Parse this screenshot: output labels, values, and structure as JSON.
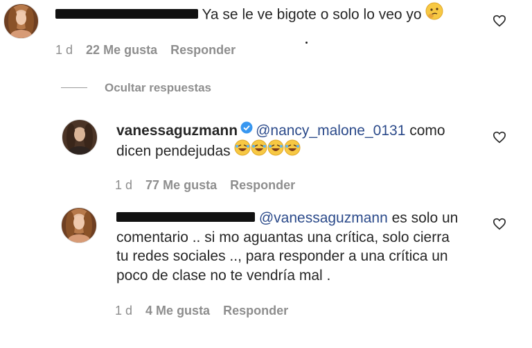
{
  "comments": [
    {
      "text": "Ya se le ve bigote o solo lo veo yo",
      "emoji": "thinking-face",
      "time": "1 d",
      "likes": "22 Me gusta",
      "reply": "Responder"
    },
    {
      "username": "vanessaguzmann",
      "mention": "@nancy_malone_0131",
      "text_line1": "como",
      "text_line2": "dicen pendejudas",
      "emoji": "rolling-on-floor-laughing",
      "time": "1 d",
      "likes": "77 Me gusta",
      "reply": "Responder"
    },
    {
      "mention": "@vanessaguzmann",
      "text_line1": "es solo un",
      "text_line2": "comentario .. si mo aguantas una crítica, solo cierra",
      "text_line3": "tu redes sociales .., para responder a una crítica un",
      "text_line4": "poco de clase no te vendría mal .",
      "time": "1 d",
      "likes": "4 Me gusta",
      "reply": "Responder"
    }
  ],
  "hide_replies": "Ocultar respuestas",
  "colors": {
    "mention": "#2b4a8a",
    "meta": "#8e8e8e",
    "text": "#262626"
  }
}
